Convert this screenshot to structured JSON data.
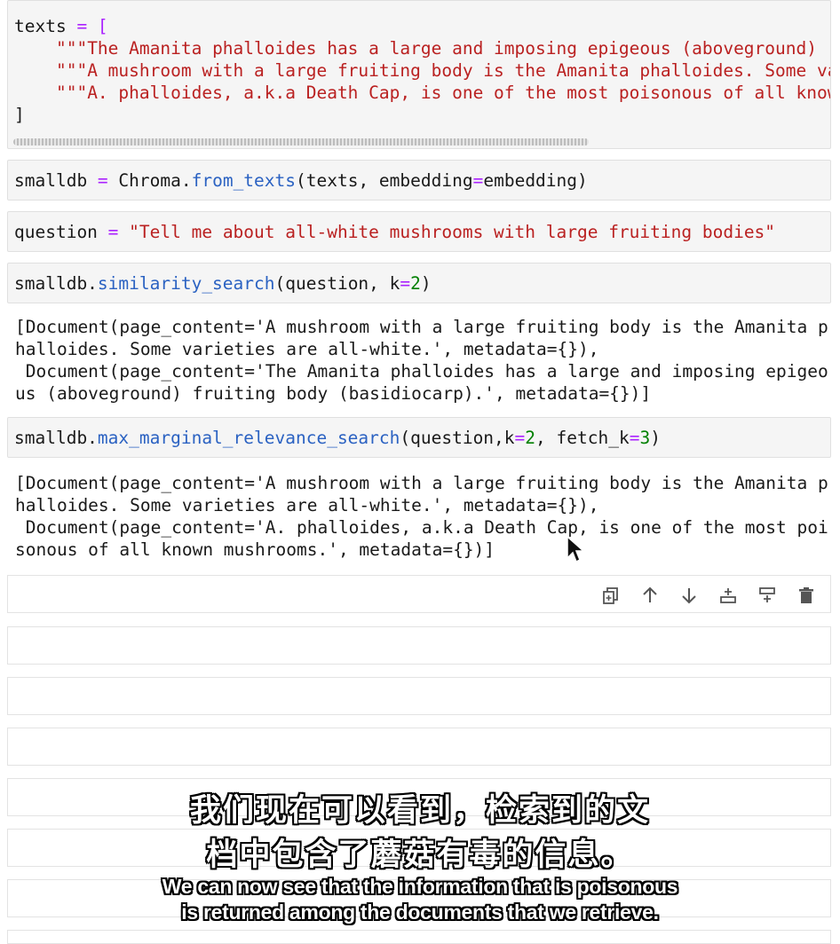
{
  "cells": {
    "texts_cell": {
      "line1_a": "texts",
      "line1_b": " = [",
      "line2_quote": "    \"\"\"",
      "line2_text": "The Amanita phalloides has a large and imposing epigeous (aboveground) ",
      "line3_quote": "    \"\"\"",
      "line3_text": "A mushroom with a large fruiting body is the Amanita phalloides. Some va",
      "line4_quote": "    \"\"\"",
      "line4_text": "A. phalloides, a.k.a Death Cap, is one of the most poisonous of all know",
      "line5": "]"
    },
    "smalldb_cell": {
      "var": "smalldb",
      "eq": " = ",
      "obj": "Chroma.",
      "method": "from_texts",
      "args_a": "(texts, embedding",
      "args_eq": "=",
      "args_b": "embedding)"
    },
    "question_cell": {
      "var": "question",
      "eq": " = ",
      "value": "\"Tell me about all-white mushrooms with large fruiting bodies\""
    },
    "sim_cell": {
      "obj": "smalldb.",
      "method": "similarity_search",
      "args_a": "(question, k",
      "args_eq": "=",
      "args_num": "2",
      "args_b": ")"
    },
    "sim_output": [
      "[Document(page_content='A mushroom with a large fruiting body is the Amanita p",
      "halloides. Some varieties are all-white.', metadata={}),",
      " Document(page_content='The Amanita phalloides has a large and imposing epigeo",
      "us (aboveground) fruiting body (basidiocarp).', metadata={})]"
    ],
    "mmr_cell": {
      "obj": "smalldb.",
      "method": "max_marginal_relevance_search",
      "args_a": "(question,k",
      "args_eq1": "=",
      "args_num1": "2",
      "args_b": ", fetch_k",
      "args_eq2": "=",
      "args_num2": "3",
      "args_c": ")"
    },
    "mmr_output": [
      "[Document(page_content='A mushroom with a large fruiting body is the Amanita p",
      "halloides. Some varieties are all-white.', metadata={}),",
      " Document(page_content='A. phalloides, a.k.a Death Cap, is one of the most poi",
      "sonous of all known mushrooms.', metadata={})]"
    ]
  },
  "toolbar": {
    "icons": [
      "duplicate-icon",
      "move-up-icon",
      "move-down-icon",
      "insert-below-icon",
      "insert-above-icon",
      "delete-icon"
    ]
  },
  "subtitles": {
    "cn_line1": "我们现在可以看到，检索到的文",
    "cn_line2": "档中包含了蘑菇有毒的信息。",
    "en_line1": "We can now see that the information that is poisonous",
    "en_line2": "is returned among the documents that we retrieve."
  }
}
